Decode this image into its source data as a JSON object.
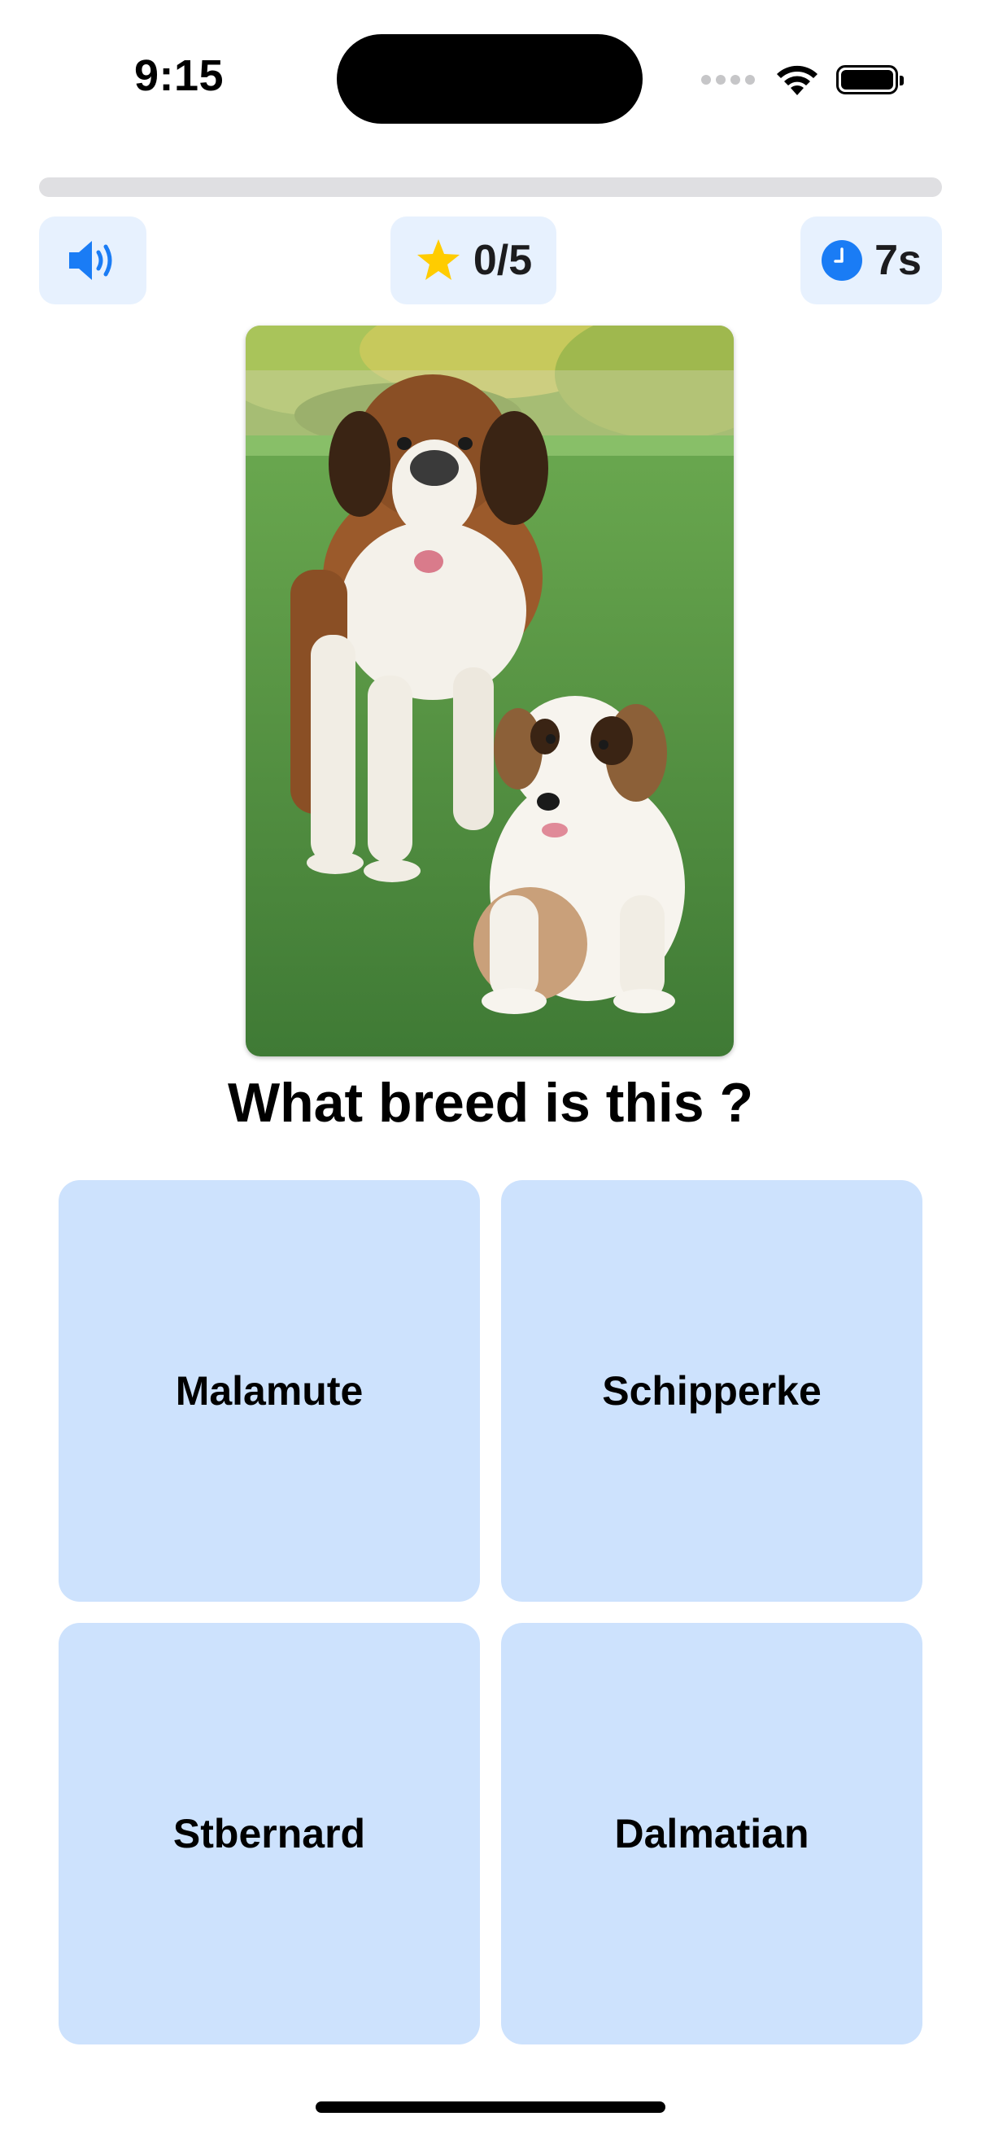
{
  "status_bar": {
    "time": "9:15"
  },
  "quiz": {
    "progress": 0.0,
    "score": "0/5",
    "timer": "7s",
    "question": "What breed is this ?",
    "answers": [
      "Malamute",
      "Schipperke",
      "Stbernard",
      "Dalmatian"
    ]
  },
  "icons": {
    "sound": "speaker-wave-icon",
    "score": "star-icon",
    "timer": "clock-icon"
  },
  "colors": {
    "accent": "#1a7cf5",
    "star": "#ffcc00",
    "pill_bg": "#e7f1fe",
    "answer_bg": "#cde2fd",
    "progress_track": "#dfdfe2"
  }
}
